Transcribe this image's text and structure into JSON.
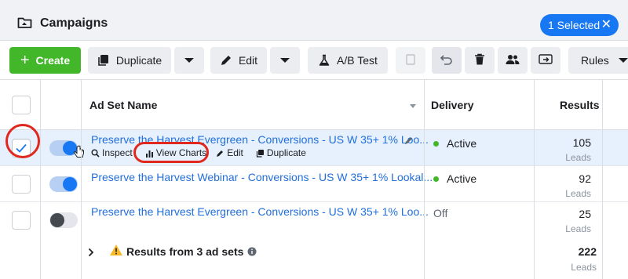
{
  "header": {
    "title": "Campaigns",
    "selected_label": "1 Selected",
    "close_glyph": "✕"
  },
  "toolbar": {
    "create_label": "Create",
    "duplicate_label": "Duplicate",
    "edit_label": "Edit",
    "ab_test_label": "A/B Test",
    "rules_label": "Rules"
  },
  "table": {
    "columns": {
      "name": "Ad Set Name",
      "delivery": "Delivery",
      "results": "Results"
    },
    "rows": [
      {
        "name": "Preserve the Harvest Evergreen - Conversions - US W 35+ 1% Loo...",
        "toggle": "on",
        "delivery": "Active",
        "result": "105",
        "result_unit": "Leads",
        "selected": true
      },
      {
        "name": "Preserve the Harvest Webinar - Conversions - US W 35+ 1% Lookal...",
        "toggle": "on",
        "delivery": "Active",
        "result": "92",
        "result_unit": "Leads",
        "selected": false
      },
      {
        "name": "Preserve the Harvest Evergreen - Conversions - US W 35+ 1% Loo...",
        "toggle": "off",
        "delivery": "Off",
        "result": "25",
        "result_unit": "Leads",
        "selected": false
      }
    ],
    "row_actions": {
      "inspect": "Inspect",
      "view_charts": "View Charts",
      "edit": "Edit",
      "duplicate": "Duplicate"
    },
    "summary": {
      "label": "Results from 3 ad sets",
      "total": "222",
      "unit": "Leads"
    }
  },
  "colors": {
    "accent": "#1877f2",
    "create_green": "#42b72a",
    "link_blue": "#216fdb",
    "highlight_red": "#e0281f",
    "selected_row": "#e7f0fd",
    "warning": "#f7b928"
  }
}
